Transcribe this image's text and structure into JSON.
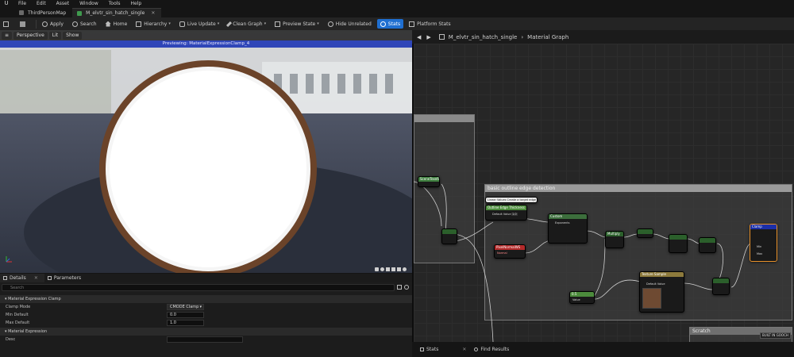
{
  "menu": {
    "items": [
      "File",
      "Edit",
      "Asset",
      "Window",
      "Tools",
      "Help"
    ]
  },
  "tabs": [
    {
      "label": "ThirdPersonMap",
      "color": "#6a6a6a"
    },
    {
      "label": "M_elvtr_sin_hatch_single",
      "color": "#3f9a4e"
    }
  ],
  "toolbar": {
    "apply": "Apply",
    "search": "Search",
    "home": "Home",
    "hierarchy": "Hierarchy",
    "live_update": "Live Update",
    "clean_graph": "Clean Graph",
    "preview_state": "Preview State",
    "hide_unrelated": "Hide Unrelated",
    "stats": "Stats",
    "platform_stats": "Platform Stats"
  },
  "viewport": {
    "perspective": "Perspective",
    "lit": "Lit",
    "show": "Show",
    "banner": "Previewing: MaterialExpressionClamp_4"
  },
  "details": {
    "tab_details": "Details",
    "tab_parameters": "Parameters",
    "search_placeholder": "Search",
    "section_clamp": "Material Expression Clamp",
    "clamp_mode_label": "Clamp Mode",
    "clamp_mode_value": "CMODE Clamp",
    "min_default_label": "Min Default",
    "min_default_value": "0.0",
    "max_default_label": "Max Default",
    "max_default_value": "1.0",
    "section_expression": "Material Expression",
    "desc_label": "Desc"
  },
  "graph": {
    "breadcrumb_asset": "M_elvtr_sin_hatch_single",
    "breadcrumb_view": "Material Graph",
    "comment_title": "basic outline edge detection",
    "bottom_comment": "Scratch",
    "built_badge": "BUILT IN GOOCH",
    "nodes": {
      "comment_note": "Linear Values Create a target edge",
      "scene_texel": "SceneTexelSize",
      "scalar_param": "Outline Edge Thickness",
      "default_value": "Default Value",
      "default_value_num": "1.0",
      "custom": "Custom",
      "exponent": "Exponents",
      "multiply1": "Multiply",
      "pixel_normal": "PixelNormalWS",
      "pixel_sub": "Normal",
      "clamp": "Clamp",
      "clamp_min": "Min",
      "clamp_max": "Max",
      "tex_sample": "Texture Sample",
      "tex_default": "Default Value",
      "const": "0.5",
      "value_label": "Value"
    }
  },
  "footer": {
    "stats": "Stats",
    "find_results": "Find Results"
  }
}
